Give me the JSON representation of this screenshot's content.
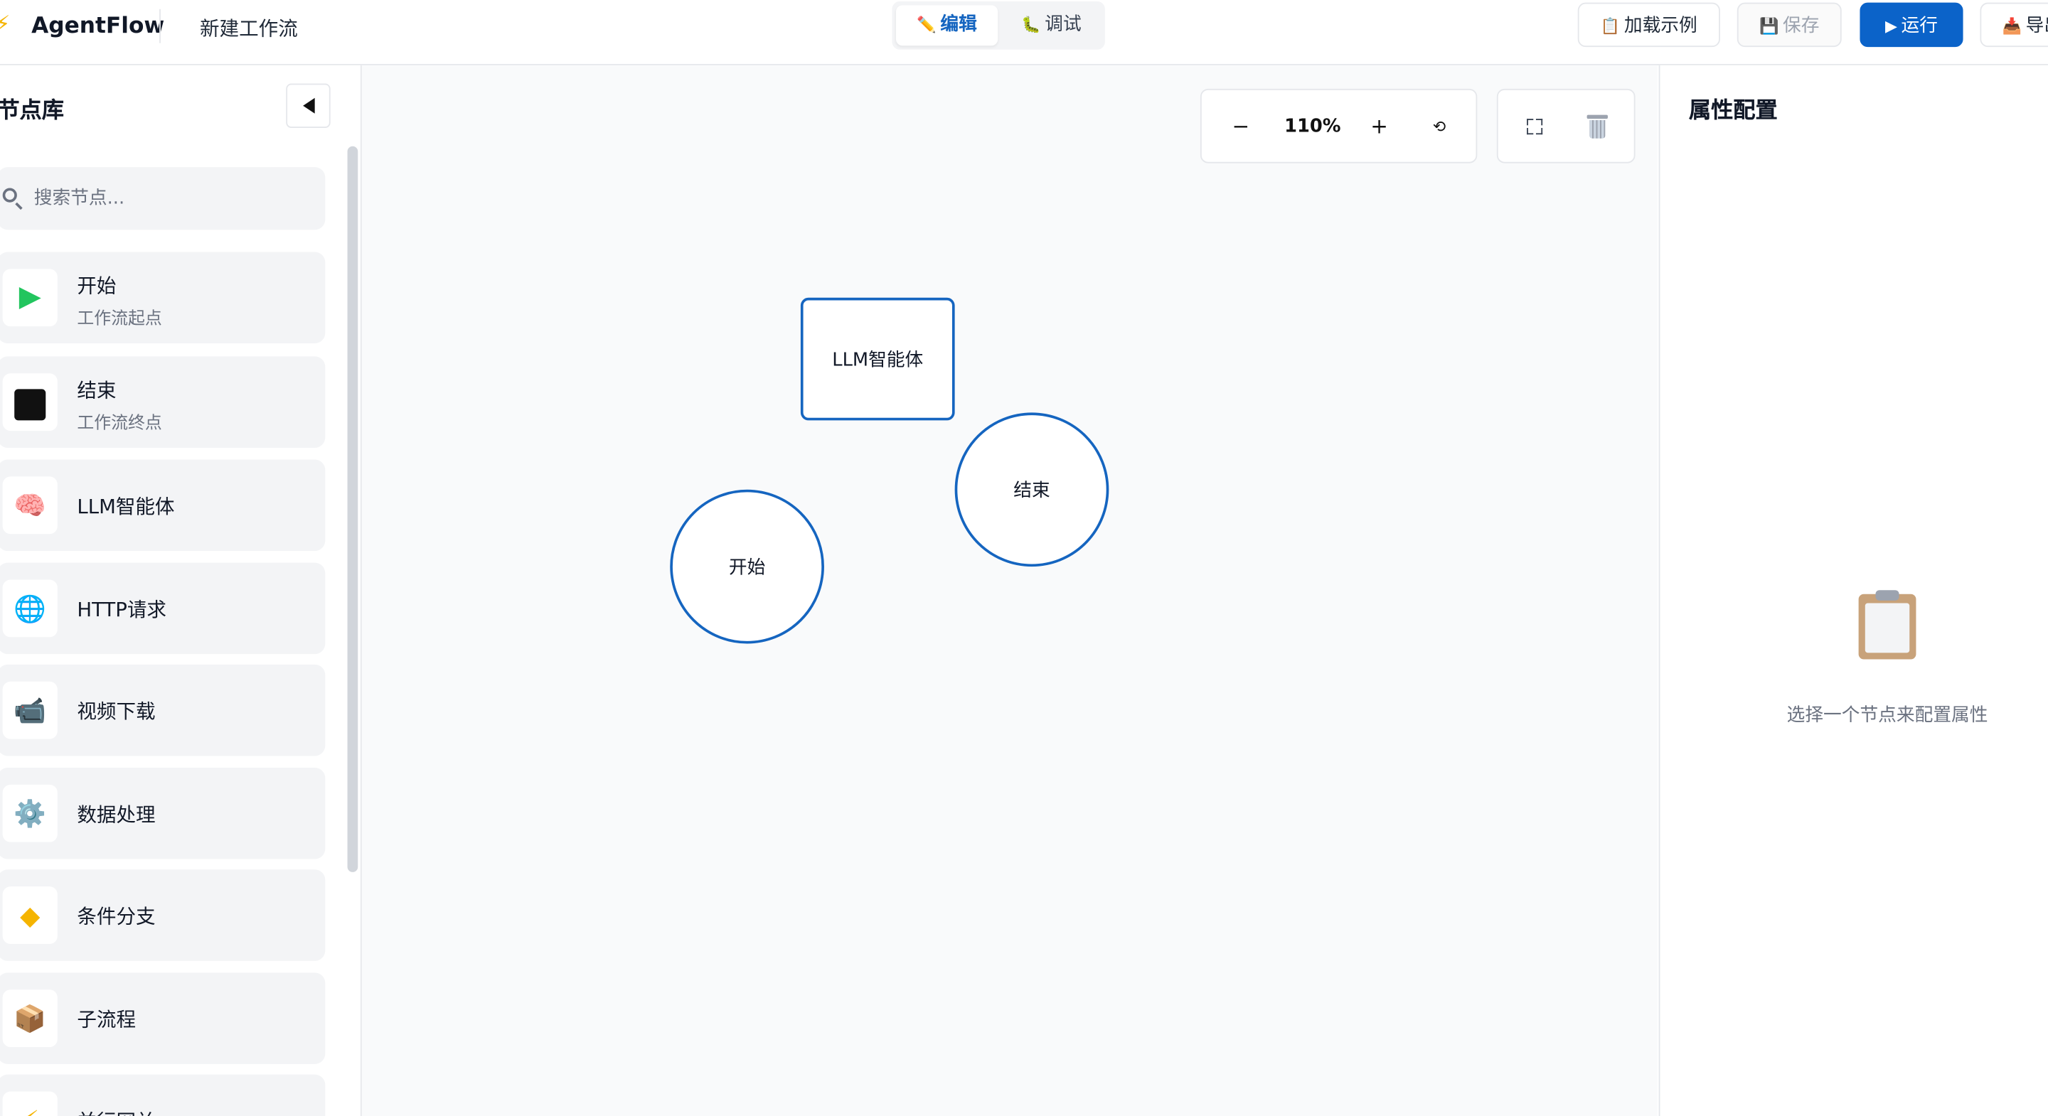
{
  "header": {
    "app_title": "AgentFlow",
    "workflow_name": "新建工作流",
    "modes": {
      "edit": "编辑",
      "debug": "调试"
    },
    "buttons": {
      "load_example": "加载示例",
      "save": "保存",
      "run": "运行",
      "export": "导出"
    }
  },
  "sidebar": {
    "title": "节点库",
    "search_placeholder": "搜索节点...",
    "items": [
      {
        "name": "开始",
        "desc": "工作流起点",
        "icon": "play-icon"
      },
      {
        "name": "结束",
        "desc": "工作流终点",
        "icon": "stop-icon"
      },
      {
        "name": "LLM智能体",
        "icon": "brain-icon"
      },
      {
        "name": "HTTP请求",
        "icon": "globe-icon"
      },
      {
        "name": "视频下载",
        "icon": "video-camera-icon"
      },
      {
        "name": "数据处理",
        "icon": "gear-icon"
      },
      {
        "name": "条件分支",
        "icon": "diamond-icon"
      },
      {
        "name": "子流程",
        "icon": "package-icon"
      },
      {
        "name": "并行网关",
        "icon": "lightning-icon"
      }
    ]
  },
  "canvas": {
    "zoom": "110%",
    "nodes": {
      "llm": "LLM智能体",
      "end": "结束",
      "start": "开始"
    }
  },
  "properties": {
    "title": "属性配置",
    "empty_message": "选择一个节点来配置属性"
  },
  "colors": {
    "accent": "#1565c0",
    "run_button": "#0b63c9",
    "start_green": "#22c55e"
  }
}
